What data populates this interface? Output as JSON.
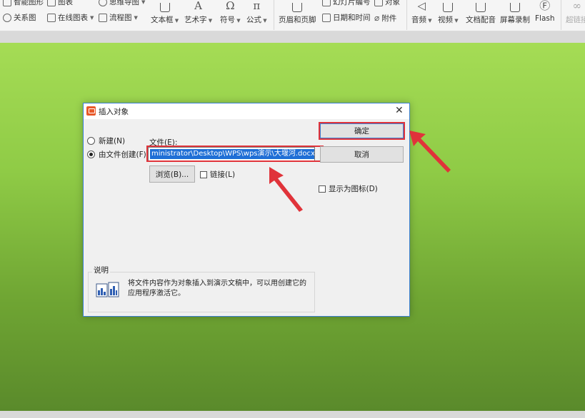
{
  "ribbon": {
    "smart_graphic": "智能图形",
    "chart": "图表",
    "mind_map": "思维导图",
    "relation_chart": "关系图",
    "online_chart": "在线图表",
    "flowchart": "流程图",
    "textbox": "文本框",
    "wordart": "艺术字",
    "symbol": "符号",
    "formula": "公式",
    "header_footer": "页眉和页脚",
    "slide_number": "幻灯片编号",
    "object": "对象",
    "date_time": "日期和时间",
    "attachment": "附件",
    "audio": "音频",
    "video": "视频",
    "text_dubbing": "文档配音",
    "screen_record": "屏幕录制",
    "flash": "Flash",
    "hyperlink": "超链接"
  },
  "dialog": {
    "title": "插入对象",
    "close_glyph": "✕",
    "radio_new": "新建(N)",
    "radio_from_file": "由文件创建(F)",
    "file_label": "文件(E):",
    "file_value": "ministrator\\Desktop\\WPS\\wps演示\\大堰河.docx",
    "browse": "浏览(B)...",
    "link": "链接(L)",
    "ok": "确定",
    "cancel": "取消",
    "display_as_icon": "显示为图标(D)",
    "result_legend": "说明",
    "result_text": "将文件内容作为对象插入到演示文稿中，可以用创建它的应用程序激活它。"
  },
  "colors": {
    "accent_blue": "#3a7fd4",
    "annotation_red": "#e0333a",
    "slide_green_top": "#a5dc55",
    "slide_green_bottom": "#5a8a2b"
  }
}
